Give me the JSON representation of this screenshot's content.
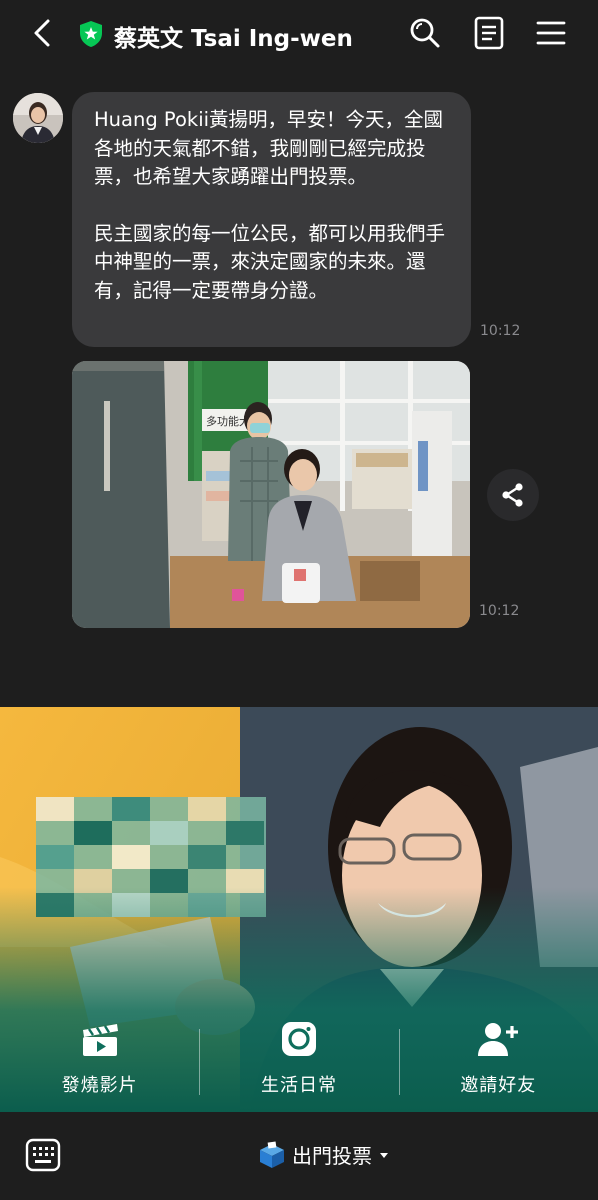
{
  "header": {
    "title": "蔡英文 Tsai Ing-wen"
  },
  "chat": {
    "message_paragraphs": [
      "Huang Pokii黃揚明，早安！今天，全國各地的天氣都不錯，我剛剛已經完成投票，也希望大家踴躍出門投票。",
      "民主國家的每一位公民，都可以用我們手中神聖的一票，來決定國家的未來。還有，記得一定要帶身分證。"
    ],
    "message_time": "10:12",
    "photo_time": "10:12",
    "photo_sign_text": "多功能大"
  },
  "rich_menu": {
    "buttons": [
      {
        "label": "發燒影片",
        "icon": "clapperboard-icon"
      },
      {
        "label": "生活日常",
        "icon": "camera-icon"
      },
      {
        "label": "邀請好友",
        "icon": "add-friend-icon"
      }
    ]
  },
  "footer": {
    "menu_label": "出門投票",
    "menu_icon": "ballot-box-icon"
  },
  "colors": {
    "background": "#1e1e1e",
    "bubble": "#3a3a3c",
    "badge_green": "#06c755",
    "menu_teal": "#0f6e5c",
    "menu_yellow": "#f2b33d"
  }
}
